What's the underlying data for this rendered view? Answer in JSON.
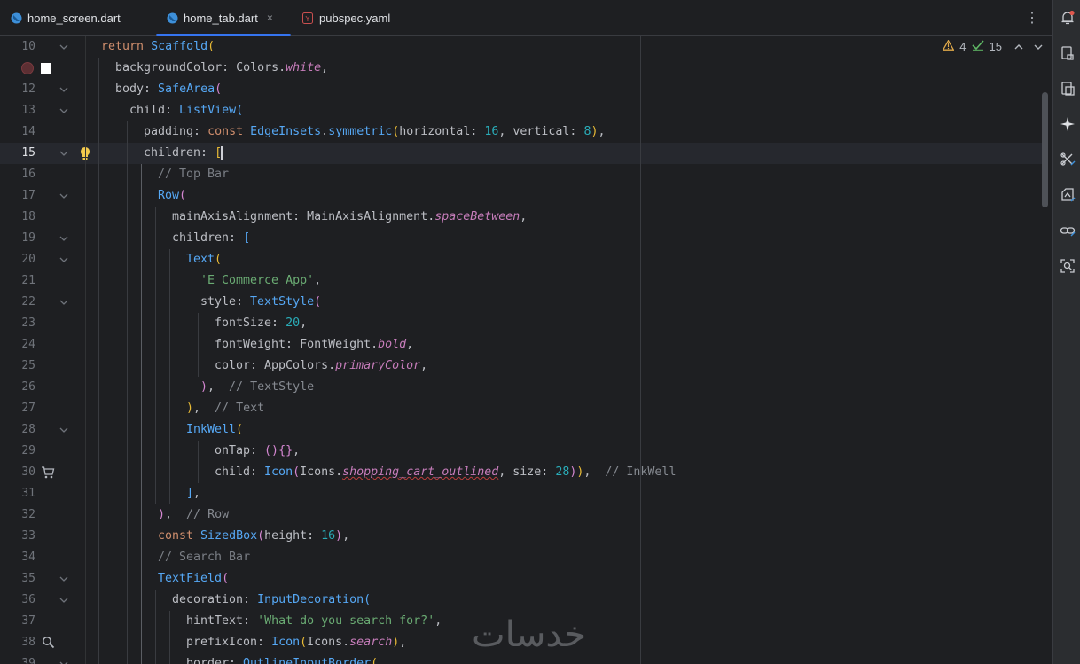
{
  "tabs": [
    {
      "label": "home_screen.dart",
      "active": false
    },
    {
      "label": "home_tab.dart",
      "active": true
    },
    {
      "label": "pubspec.yaml",
      "active": false
    }
  ],
  "tab_close_glyph": "×",
  "tab_menu_glyph": "⋮",
  "inspection": {
    "warnings": "4",
    "checks": "15"
  },
  "lines": [
    {
      "n": "10",
      "indent": 0,
      "html": "<span class='kw'>return</span> <span class='fn'>Scaffold</span><span class='b1'>(</span>"
    },
    {
      "n": "",
      "indent": 1,
      "html": "backgroundColor: Colors.<span class='prop'>white</span>,"
    },
    {
      "n": "12",
      "indent": 1,
      "html": "body: <span class='fn'>SafeArea</span><span class='b2'>(</span>"
    },
    {
      "n": "13",
      "indent": 2,
      "html": "child: <span class='fn'>ListView</span><span class='b3'>(</span>"
    },
    {
      "n": "14",
      "indent": 3,
      "html": "padding: <span class='kw'>const</span> <span class='fn'>EdgeInsets</span>.<span class='fn'>symmetric</span><span class='b1'>(</span>horizontal: <span class='num'>16</span>, vertical: <span class='num'>8</span><span class='b1'>)</span>,"
    },
    {
      "n": "15",
      "indent": 3,
      "html": "children: <span class='b1'>[</span><span class='caret'></span>"
    },
    {
      "n": "16",
      "indent": 4,
      "html": "<span class='cmt'>// Top Bar</span>"
    },
    {
      "n": "17",
      "indent": 4,
      "html": "<span class='fn'>Row</span><span class='b2'>(</span>"
    },
    {
      "n": "18",
      "indent": 5,
      "html": "mainAxisAlignment: MainAxisAlignment.<span class='prop'>spaceBetween</span>,"
    },
    {
      "n": "19",
      "indent": 5,
      "html": "children: <span class='b3'>[</span>"
    },
    {
      "n": "20",
      "indent": 6,
      "html": "<span class='fn'>Text</span><span class='b1'>(</span>"
    },
    {
      "n": "21",
      "indent": 7,
      "html": "<span class='str'>'E Commerce App'</span>,"
    },
    {
      "n": "22",
      "indent": 7,
      "html": "style: <span class='fn'>TextStyle</span><span class='b2'>(</span>"
    },
    {
      "n": "23",
      "indent": 8,
      "html": "fontSize: <span class='num'>20</span>,"
    },
    {
      "n": "24",
      "indent": 8,
      "html": "fontWeight: FontWeight.<span class='prop'>bold</span>,"
    },
    {
      "n": "25",
      "indent": 8,
      "html": "color: AppColors.<span class='prop'>primaryColor</span>,"
    },
    {
      "n": "26",
      "indent": 7,
      "html": "<span class='b2'>)</span>,  <span class='hint'>// TextStyle</span>"
    },
    {
      "n": "27",
      "indent": 6,
      "html": "<span class='b1'>)</span>,  <span class='hint'>// Text</span>"
    },
    {
      "n": "28",
      "indent": 6,
      "html": "<span class='fn'>InkWell</span><span class='b1'>(</span>"
    },
    {
      "n": "29",
      "indent": 8,
      "html": "onTap: <span class='b2'>()</span><span class='b2'>{}</span>,"
    },
    {
      "n": "30",
      "indent": 8,
      "html": "child: <span class='fn'>Icon</span><span class='b2'>(</span>Icons.<span class='prop wavy'>shopping_cart_outlined</span>, size: <span class='num'>28</span><span class='b2'>)</span><span class='b1'>)</span>,  <span class='hint'>// InkWell</span>"
    },
    {
      "n": "31",
      "indent": 6,
      "html": "<span class='b3'>]</span>,"
    },
    {
      "n": "32",
      "indent": 4,
      "html": "<span class='b2'>)</span>,  <span class='hint'>// Row</span>"
    },
    {
      "n": "33",
      "indent": 4,
      "html": "<span class='kw'>const</span> <span class='fn'>SizedBox</span><span class='b2'>(</span>height: <span class='num'>16</span><span class='b2'>)</span>,"
    },
    {
      "n": "34",
      "indent": 4,
      "html": "<span class='cmt'>// Search Bar</span>"
    },
    {
      "n": "35",
      "indent": 4,
      "html": "<span class='fn'>TextField</span><span class='b2'>(</span>"
    },
    {
      "n": "36",
      "indent": 5,
      "html": "decoration: <span class='fn'>InputDecoration</span><span class='b3'>(</span>"
    },
    {
      "n": "37",
      "indent": 6,
      "html": "hintText: <span class='str'>'What do you search for?'</span>,"
    },
    {
      "n": "38",
      "indent": 6,
      "html": "prefixIcon: <span class='fn'>Icon</span><span class='b1'>(</span>Icons.<span class='prop'>search</span><span class='b1'>)</span>,"
    },
    {
      "n": "39",
      "indent": 6,
      "html": "border: <span class='fn'>OutlineInputBorder</span><span class='b1'>(</span>"
    }
  ],
  "watermark": "خدسات"
}
